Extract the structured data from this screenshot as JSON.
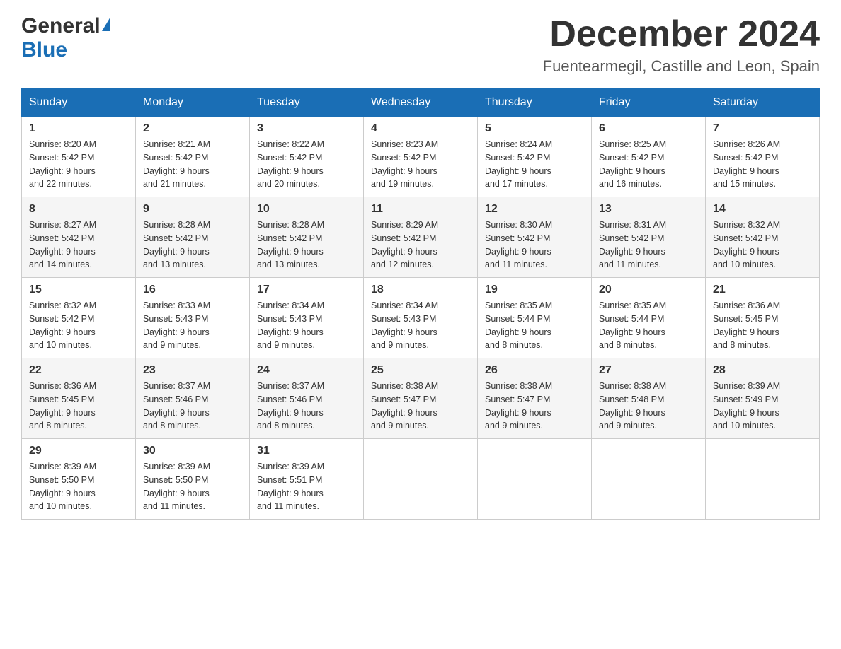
{
  "header": {
    "logo_general": "General",
    "logo_blue": "Blue",
    "month_title": "December 2024",
    "location": "Fuentearmegil, Castille and Leon, Spain"
  },
  "days_of_week": [
    "Sunday",
    "Monday",
    "Tuesday",
    "Wednesday",
    "Thursday",
    "Friday",
    "Saturday"
  ],
  "weeks": [
    {
      "days": [
        {
          "num": "1",
          "sunrise": "8:20 AM",
          "sunset": "5:42 PM",
          "daylight": "9 hours and 22 minutes."
        },
        {
          "num": "2",
          "sunrise": "8:21 AM",
          "sunset": "5:42 PM",
          "daylight": "9 hours and 21 minutes."
        },
        {
          "num": "3",
          "sunrise": "8:22 AM",
          "sunset": "5:42 PM",
          "daylight": "9 hours and 20 minutes."
        },
        {
          "num": "4",
          "sunrise": "8:23 AM",
          "sunset": "5:42 PM",
          "daylight": "9 hours and 19 minutes."
        },
        {
          "num": "5",
          "sunrise": "8:24 AM",
          "sunset": "5:42 PM",
          "daylight": "9 hours and 17 minutes."
        },
        {
          "num": "6",
          "sunrise": "8:25 AM",
          "sunset": "5:42 PM",
          "daylight": "9 hours and 16 minutes."
        },
        {
          "num": "7",
          "sunrise": "8:26 AM",
          "sunset": "5:42 PM",
          "daylight": "9 hours and 15 minutes."
        }
      ]
    },
    {
      "days": [
        {
          "num": "8",
          "sunrise": "8:27 AM",
          "sunset": "5:42 PM",
          "daylight": "9 hours and 14 minutes."
        },
        {
          "num": "9",
          "sunrise": "8:28 AM",
          "sunset": "5:42 PM",
          "daylight": "9 hours and 13 minutes."
        },
        {
          "num": "10",
          "sunrise": "8:28 AM",
          "sunset": "5:42 PM",
          "daylight": "9 hours and 13 minutes."
        },
        {
          "num": "11",
          "sunrise": "8:29 AM",
          "sunset": "5:42 PM",
          "daylight": "9 hours and 12 minutes."
        },
        {
          "num": "12",
          "sunrise": "8:30 AM",
          "sunset": "5:42 PM",
          "daylight": "9 hours and 11 minutes."
        },
        {
          "num": "13",
          "sunrise": "8:31 AM",
          "sunset": "5:42 PM",
          "daylight": "9 hours and 11 minutes."
        },
        {
          "num": "14",
          "sunrise": "8:32 AM",
          "sunset": "5:42 PM",
          "daylight": "9 hours and 10 minutes."
        }
      ]
    },
    {
      "days": [
        {
          "num": "15",
          "sunrise": "8:32 AM",
          "sunset": "5:42 PM",
          "daylight": "9 hours and 10 minutes."
        },
        {
          "num": "16",
          "sunrise": "8:33 AM",
          "sunset": "5:43 PM",
          "daylight": "9 hours and 9 minutes."
        },
        {
          "num": "17",
          "sunrise": "8:34 AM",
          "sunset": "5:43 PM",
          "daylight": "9 hours and 9 minutes."
        },
        {
          "num": "18",
          "sunrise": "8:34 AM",
          "sunset": "5:43 PM",
          "daylight": "9 hours and 9 minutes."
        },
        {
          "num": "19",
          "sunrise": "8:35 AM",
          "sunset": "5:44 PM",
          "daylight": "9 hours and 8 minutes."
        },
        {
          "num": "20",
          "sunrise": "8:35 AM",
          "sunset": "5:44 PM",
          "daylight": "9 hours and 8 minutes."
        },
        {
          "num": "21",
          "sunrise": "8:36 AM",
          "sunset": "5:45 PM",
          "daylight": "9 hours and 8 minutes."
        }
      ]
    },
    {
      "days": [
        {
          "num": "22",
          "sunrise": "8:36 AM",
          "sunset": "5:45 PM",
          "daylight": "9 hours and 8 minutes."
        },
        {
          "num": "23",
          "sunrise": "8:37 AM",
          "sunset": "5:46 PM",
          "daylight": "9 hours and 8 minutes."
        },
        {
          "num": "24",
          "sunrise": "8:37 AM",
          "sunset": "5:46 PM",
          "daylight": "9 hours and 8 minutes."
        },
        {
          "num": "25",
          "sunrise": "8:38 AM",
          "sunset": "5:47 PM",
          "daylight": "9 hours and 9 minutes."
        },
        {
          "num": "26",
          "sunrise": "8:38 AM",
          "sunset": "5:47 PM",
          "daylight": "9 hours and 9 minutes."
        },
        {
          "num": "27",
          "sunrise": "8:38 AM",
          "sunset": "5:48 PM",
          "daylight": "9 hours and 9 minutes."
        },
        {
          "num": "28",
          "sunrise": "8:39 AM",
          "sunset": "5:49 PM",
          "daylight": "9 hours and 10 minutes."
        }
      ]
    },
    {
      "days": [
        {
          "num": "29",
          "sunrise": "8:39 AM",
          "sunset": "5:50 PM",
          "daylight": "9 hours and 10 minutes."
        },
        {
          "num": "30",
          "sunrise": "8:39 AM",
          "sunset": "5:50 PM",
          "daylight": "9 hours and 11 minutes."
        },
        {
          "num": "31",
          "sunrise": "8:39 AM",
          "sunset": "5:51 PM",
          "daylight": "9 hours and 11 minutes."
        },
        null,
        null,
        null,
        null
      ]
    }
  ]
}
